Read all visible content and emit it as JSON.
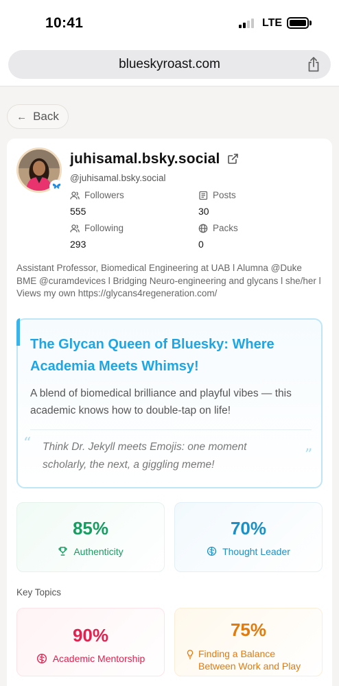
{
  "status_bar": {
    "time": "10:41",
    "network": "LTE"
  },
  "browser": {
    "url": "blueskyroast.com"
  },
  "nav": {
    "back_label": "Back"
  },
  "profile": {
    "name": "juhisamal.bsky.social",
    "handle": "@juhisamal.bsky.social",
    "stats": {
      "followers_label": "Followers",
      "followers_value": "555",
      "posts_label": "Posts",
      "posts_value": "30",
      "following_label": "Following",
      "following_value": "293",
      "packs_label": "Packs",
      "packs_value": "0"
    },
    "bio": "Assistant Professor, Biomedical Engineering at UAB l Alumna @Duke BME @curamdevices l Bridging Neuro-engineering and glycans l she/her l Views my own https://glycans4regeneration.com/"
  },
  "roast": {
    "title": "The Glycan Queen of Bluesky: Where Academia Meets Whimsy!",
    "description": "A blend of biomedical brilliance and playful vibes — this academic knows how to double-tap on life!",
    "quote": "Think Dr. Jekyll meets Emojis: one moment scholarly, the next, a giggling meme!"
  },
  "scores": [
    {
      "value": "85%",
      "label": "Authenticity",
      "color": "#1a9b62",
      "icon": "trophy-icon"
    },
    {
      "value": "70%",
      "label": "Thought Leader",
      "color": "#1d8fc4",
      "icon": "brain-icon"
    }
  ],
  "key_topics_label": "Key Topics",
  "topics": [
    {
      "value": "90%",
      "label": "Academic Mentorship",
      "color": "#e0224f",
      "icon": "brain-icon"
    },
    {
      "value": "75%",
      "label": "Finding a Balance Between Work and Play",
      "color": "#e07b10",
      "icon": "lightbulb-icon"
    }
  ],
  "colors": {
    "accent": "#1ea5e4",
    "background": "#f6f4f2"
  }
}
